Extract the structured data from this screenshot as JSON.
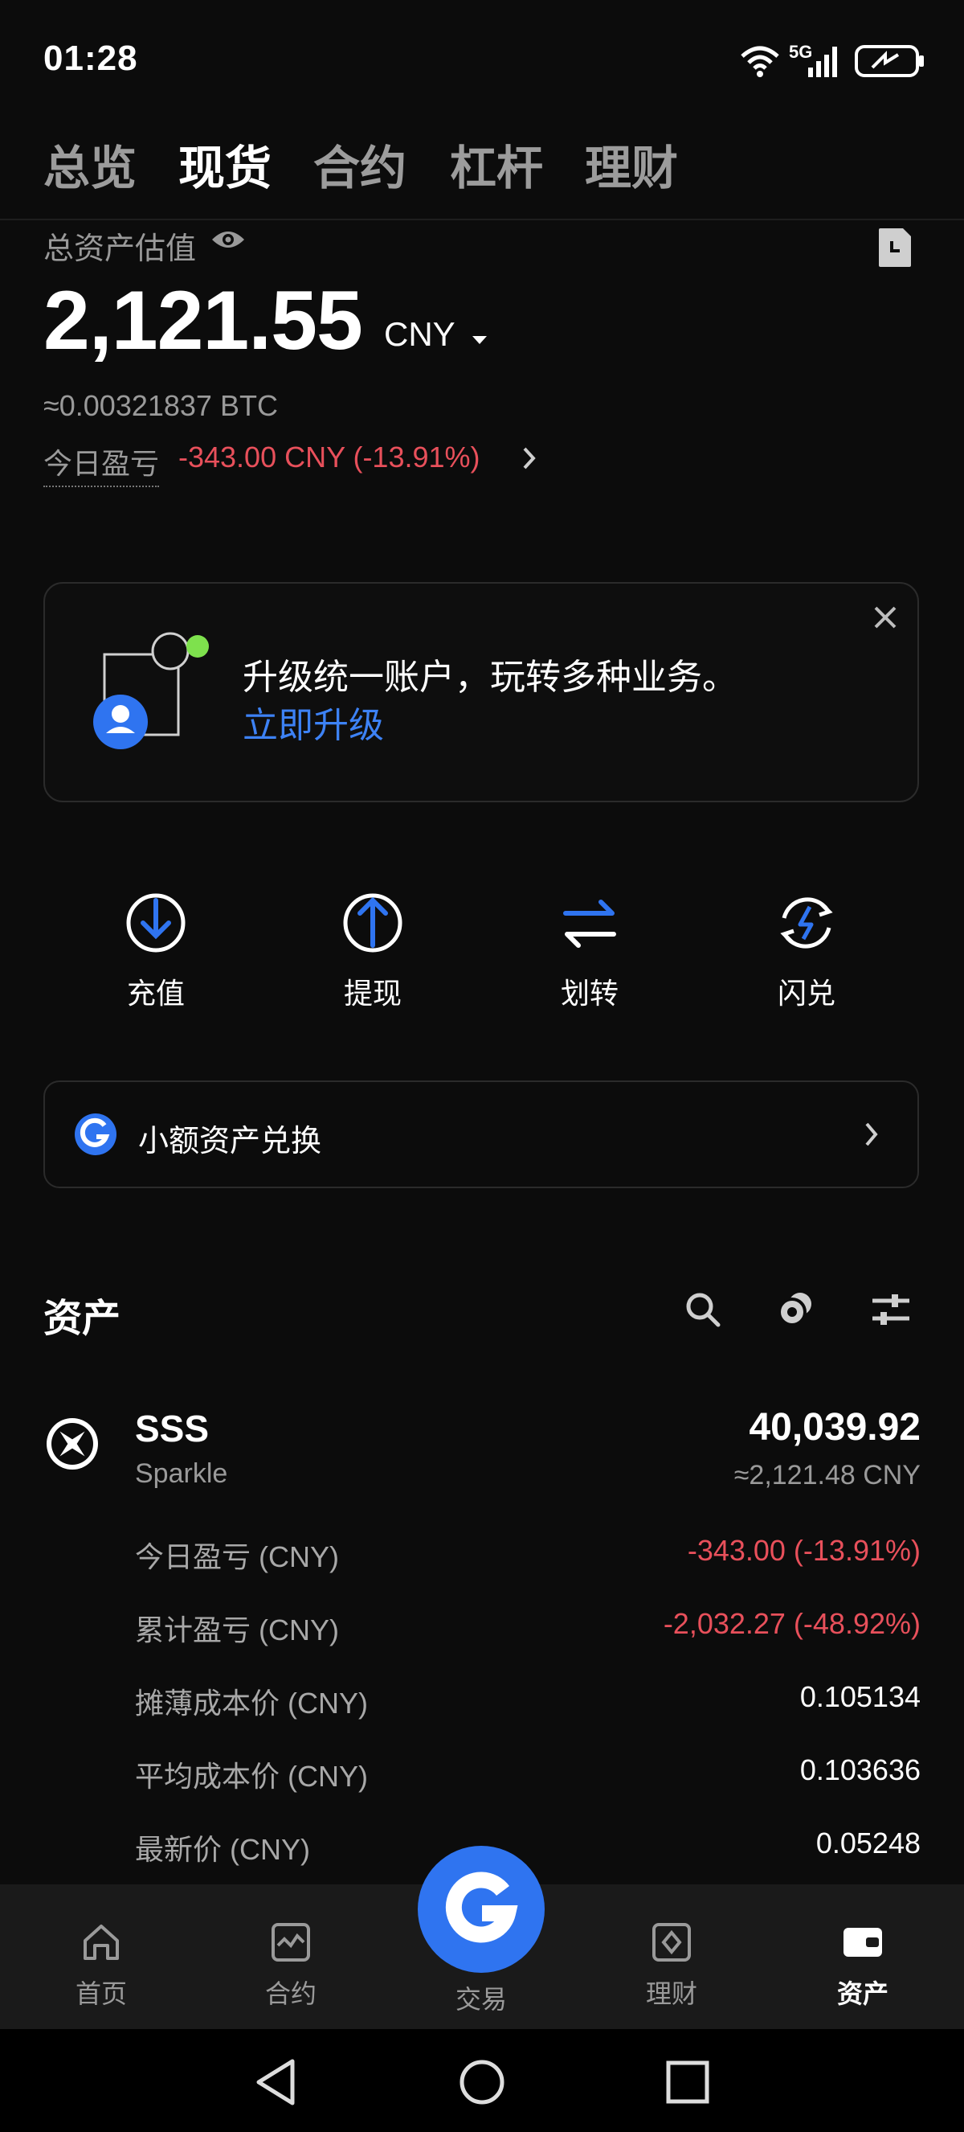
{
  "status_bar": {
    "time": "01:28",
    "network": "5G"
  },
  "top_tabs": [
    {
      "label": "总览",
      "active": false
    },
    {
      "label": "现货",
      "active": true
    },
    {
      "label": "合约",
      "active": false
    },
    {
      "label": "杠杆",
      "active": false
    },
    {
      "label": "理财",
      "active": false
    }
  ],
  "summary": {
    "title": "总资产估值",
    "total": "2,121.55",
    "currency": "CNY",
    "btc_equiv": "≈0.00321837 BTC",
    "pnl_label": "今日盈亏",
    "pnl_value": "-343.00 CNY (-13.91%)"
  },
  "upgrade": {
    "text": "升级统一账户，玩转多种业务。",
    "link": "立即升级"
  },
  "actions": [
    {
      "label": "充值",
      "icon": "deposit-icon"
    },
    {
      "label": "提现",
      "icon": "withdraw-icon"
    },
    {
      "label": "划转",
      "icon": "transfer-icon"
    },
    {
      "label": "闪兑",
      "icon": "convert-icon"
    }
  ],
  "small_asset": {
    "label": "小额资产兑换"
  },
  "assets": {
    "title": "资产",
    "coin": {
      "symbol": "SSS",
      "name": "Sparkle",
      "amount": "40,039.92",
      "cny": "≈2,121.48 CNY",
      "rows": [
        {
          "label": "今日盈亏 (CNY)",
          "value": "-343.00 (-13.91%)",
          "negative": true
        },
        {
          "label": "累计盈亏 (CNY)",
          "value": "-2,032.27 (-48.92%)",
          "negative": true
        },
        {
          "label": "摊薄成本价 (CNY)",
          "value": "0.105134",
          "negative": false
        },
        {
          "label": "平均成本价 (CNY)",
          "value": "0.103636",
          "negative": false
        },
        {
          "label": "最新价 (CNY)",
          "value": "0.05248",
          "negative": false
        }
      ]
    }
  },
  "bottom_nav": [
    {
      "label": "首页",
      "icon": "home-icon",
      "active": false
    },
    {
      "label": "合约",
      "icon": "contract-icon",
      "active": false
    },
    {
      "label": "交易",
      "icon": "trade-icon",
      "active": false
    },
    {
      "label": "理财",
      "icon": "finance-icon",
      "active": false
    },
    {
      "label": "资产",
      "icon": "wallet-icon",
      "active": true
    }
  ],
  "colors": {
    "accent": "#2f74f0",
    "negative": "#e8505b",
    "background": "#0c0c0c"
  }
}
